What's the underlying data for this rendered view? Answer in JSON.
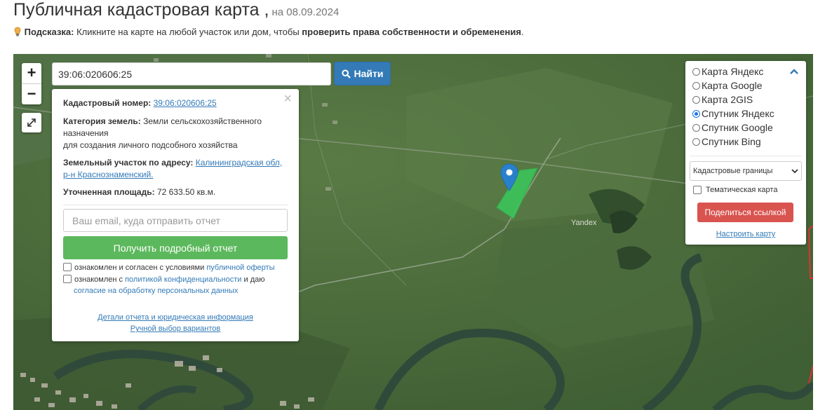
{
  "header": {
    "title": "Публичная кадастровая карта",
    "separator": ",",
    "date": "на 08.09.2024"
  },
  "hint": {
    "label": "Подсказка:",
    "text": " Кликните на карте на любой участок или дом, чтобы ",
    "bold_text": "проверить права собственности и обременения",
    "end": "."
  },
  "search": {
    "value": "39:06:020606:25",
    "button_label": "Найти"
  },
  "zoom": {
    "in": "+",
    "out": "−"
  },
  "popup": {
    "close": "×",
    "cadastral_label": "Кадастровый номер:",
    "cadastral_value": "39:06:020606:25",
    "category_label": "Категория земель:",
    "category_value": "Земли сельскохозяйственного назначения",
    "category_value_line2": "для создания личного подсобного хозяйства",
    "address_label": "Земельный участок по адресу:",
    "address_value": "Калининградская обл, р-н Краснознаменский.",
    "area_label": "Уточненная площадь:",
    "area_value": "72 633.50 кв.м.",
    "email_placeholder": "Ваш email, куда отправить отчет",
    "report_button": "Получить подробный отчет",
    "agree1_text": "ознакомлен и согласен с условиями ",
    "agree1_link": "публичной оферты",
    "agree2_text": "ознакомлен с ",
    "agree2_link": "политикой конфиденциальности",
    "agree2_text2": " и даю",
    "agree2_link2": "согласие на обработку персональных данных",
    "details_link": "Детали отчета и юридическая информация",
    "manual_link": "Ручной выбор вариантов"
  },
  "layers": {
    "options": [
      {
        "label": "Карта Яндекс",
        "selected": false
      },
      {
        "label": "Карта Google",
        "selected": false
      },
      {
        "label": "Карта 2GIS",
        "selected": false
      },
      {
        "label": "Спутник Яндекс",
        "selected": true
      },
      {
        "label": "Спутник Google",
        "selected": false
      },
      {
        "label": "Спутник Bing",
        "selected": false
      }
    ],
    "boundaries_select": "Кадастровые границы",
    "thematic_label": "Тематическая карта",
    "share_button": "Поделиться ссылкой",
    "configure_link": "Настроить карту"
  },
  "map": {
    "watermark": "Yandex",
    "parcel_color": "#3cc35a",
    "marker_color": "#2a81cb"
  }
}
